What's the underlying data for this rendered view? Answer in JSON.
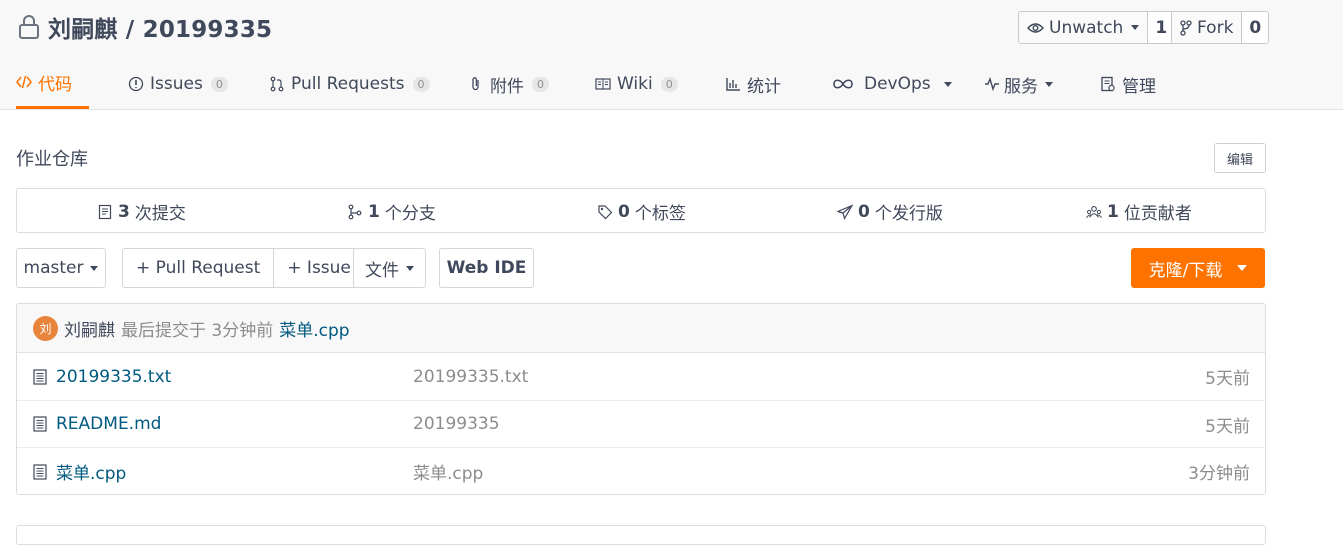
{
  "repo": {
    "name": "刘嗣麒 / 20199335"
  },
  "header_buttons": {
    "watch": {
      "label": "Unwatch",
      "count": "1"
    },
    "fork": {
      "label": "Fork",
      "count": "0"
    }
  },
  "tabs": [
    {
      "label": "代码",
      "icon": "code-icon",
      "active": true
    },
    {
      "label": "Issues",
      "badge": "0",
      "icon": "issue-icon"
    },
    {
      "label": "Pull Requests",
      "badge": "0",
      "icon": "pull-request-icon"
    },
    {
      "label": "附件",
      "badge": "0",
      "icon": "paperclip-icon"
    },
    {
      "label": "Wiki",
      "badge": "0",
      "icon": "wiki-book-icon"
    },
    {
      "label": "统计",
      "icon": "bar-chart-icon"
    },
    {
      "label": "DevOps",
      "icon": "infinity-icon"
    },
    {
      "label": "服务",
      "icon": "pulse-icon"
    },
    {
      "label": "管理",
      "icon": "settings-doc-icon"
    }
  ],
  "description": "作业仓库",
  "edit_label": "编辑",
  "stats": [
    {
      "count": "3",
      "label": "次提交"
    },
    {
      "count": "1",
      "label": "个分支"
    },
    {
      "count": "0",
      "label": "个标签"
    },
    {
      "count": "0",
      "label": "个发行版"
    },
    {
      "count": "1",
      "label": "位贡献者"
    }
  ],
  "toolbar": {
    "branch": "master",
    "pull_request": "+ Pull Request",
    "issue": "+ Issue",
    "file": "文件",
    "web_ide": "Web IDE",
    "clone": "克隆/下载"
  },
  "last_commit": {
    "avatar_text": "刘",
    "author": "刘嗣麒",
    "meta": "最后提交于 3分钟前",
    "file": "菜单.cpp"
  },
  "files": [
    {
      "name": "20199335.txt",
      "message": "20199335.txt",
      "time": "5天前"
    },
    {
      "name": "README.md",
      "message": "20199335",
      "time": "5天前"
    },
    {
      "name": "菜单.cpp",
      "message": "菜单.cpp",
      "time": "3分钟前"
    }
  ],
  "colors": {
    "accent": "#fe7300",
    "link": "#005980",
    "text": "#40485b",
    "muted": "#8c8c8c"
  }
}
